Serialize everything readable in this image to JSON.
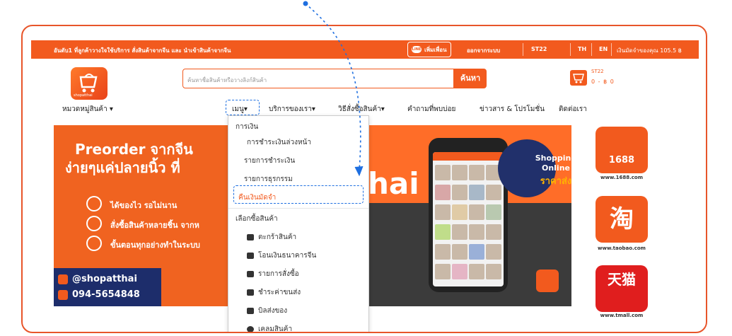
{
  "topbar": {
    "slogan": "อันดับ1 ที่ลูกค้าวางใจใช้บริการ สั่งสินค้าจากจีน และ นำเข้าสินค้าจากจีน",
    "line_button": "เพิ่มเพื่อน",
    "line_icon": "LINE",
    "logout": "ออกจากระบบ",
    "user": "ST22",
    "lang_th": "TH",
    "lang_en": "EN",
    "balance": "เงินมัดจำของคุณ 105.5 ฿"
  },
  "header": {
    "logo_text": "shopatthai",
    "search_placeholder": "ค้นหาชื่อสินค้าหรือวางลิงก์สินค้า",
    "search_button": "ค้นหา",
    "cart_label": "ST22",
    "cart_amount": "0 - ฿ 0"
  },
  "nav": {
    "categories": "หมวดหมู่สินค้า ▾",
    "menu": "เมนู▾",
    "services": "บริการของเรา▾",
    "how_to": "วิธีสั่งซื้อสินค้า▾",
    "faq": "คำถามที่พบบ่อย",
    "news": "ข่าวสาร & โปรโมชั่น",
    "contact": "ติดต่อเรา"
  },
  "dropdown": {
    "section_finance": "การเงิน",
    "items_finance": [
      "การชำระเงินล่วงหน้า",
      "รายการชำระเงิน",
      "รายการธุรกรรม",
      "คืนเงินมัดจำ"
    ],
    "section_shop": "เลือกซื้อสินค้า",
    "items_shop": [
      "ตะกร้าสินค้า",
      "โอนเงินธนาคารจีน",
      "รายการสั่งซื้อ",
      "ชำระค่าขนส่ง",
      "บิลส่งของ",
      "เคลมสินค้า"
    ]
  },
  "banner": {
    "title1": "Preorder จากจีน",
    "title2": "ง่ายๆแค่ปลายนิ้ว ที่",
    "feature1": "ได้ของไว รอไม่นาน",
    "feature2": "สั่งซื้อสินค้าหลายชิ้น จากห",
    "feature3": "ขั้นตอนทุกอย่างทำในระบบ",
    "social": "@shopatthai",
    "phone": "094-5654848",
    "brand_tail": "hai",
    "badge_line1": "Shopping",
    "badge_line2": "Online",
    "badge_line3": "ราคาส่ง"
  },
  "side": {
    "logo1_text": "1688",
    "logo1_caption": "www.1688.com",
    "logo2_text": "淘",
    "logo2_caption": "www.taobao.com",
    "logo3_text": "天猫",
    "logo3_caption": "www.tmall.com"
  },
  "colors": {
    "brand": "#f25a1e",
    "annotation": "#1e6fe0",
    "navy": "#1d2d6b"
  }
}
